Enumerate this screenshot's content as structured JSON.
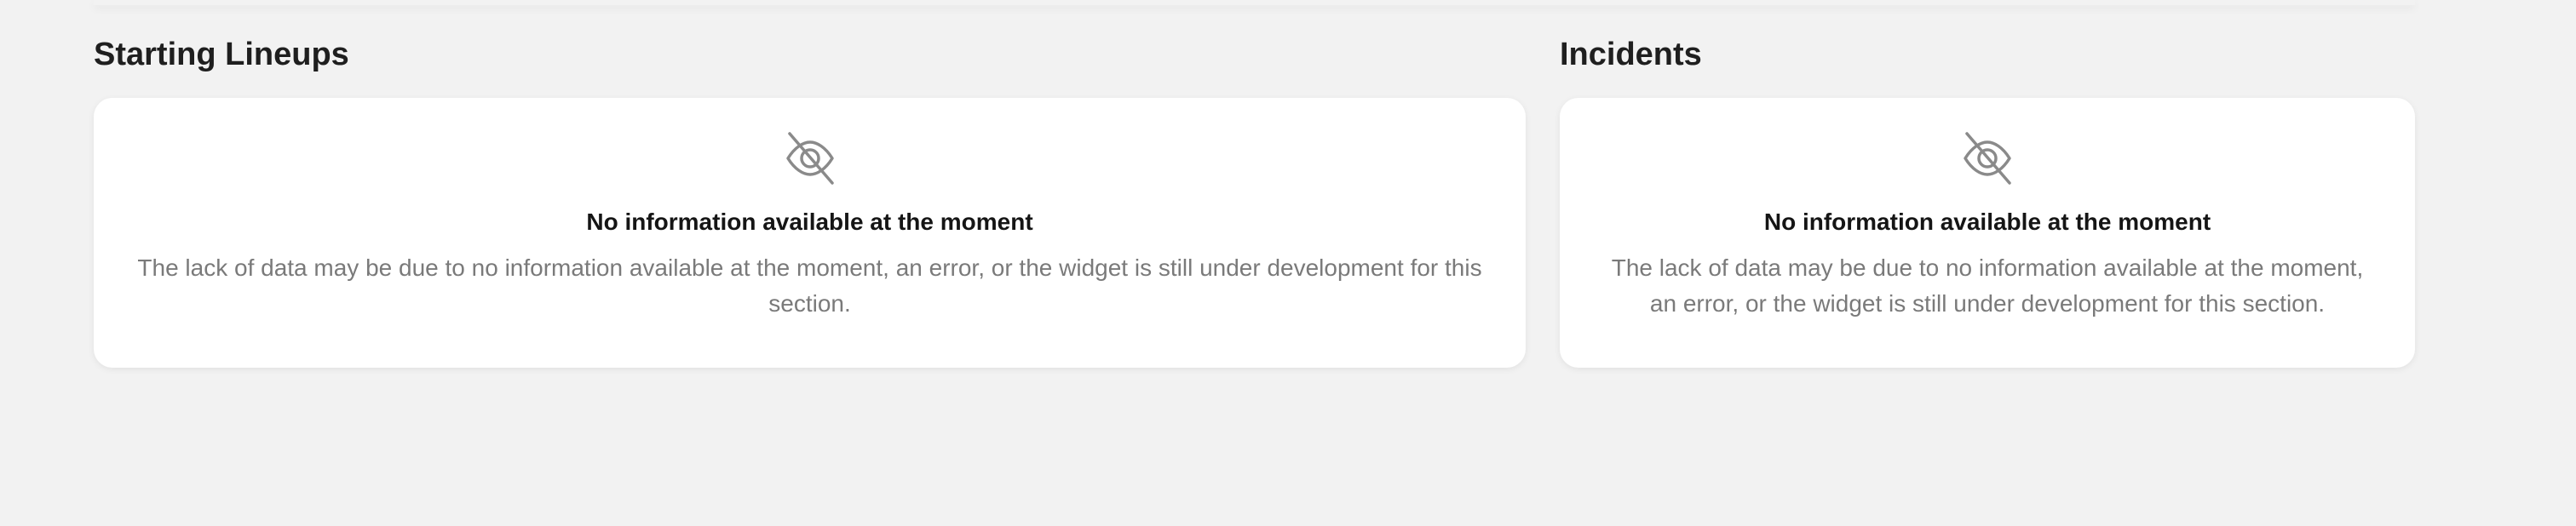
{
  "sections": [
    {
      "title": "Starting Lineups",
      "empty_state": {
        "icon": "eye-off-icon",
        "title": "No information available at the moment",
        "description": "The lack of data may be due to no information available at the moment, an error, or the widget is still under development for this section."
      }
    },
    {
      "title": "Incidents",
      "empty_state": {
        "icon": "eye-off-icon",
        "title": "No information available at the moment",
        "description": "The lack of data may be due to no information available at the moment, an error, or the widget is still under development for this section."
      }
    }
  ],
  "colors": {
    "background": "#f2f2f2",
    "card": "#ffffff",
    "title_text": "#1f1f1f",
    "muted_text": "#7a7a7a",
    "icon": "#8a8a8a"
  }
}
